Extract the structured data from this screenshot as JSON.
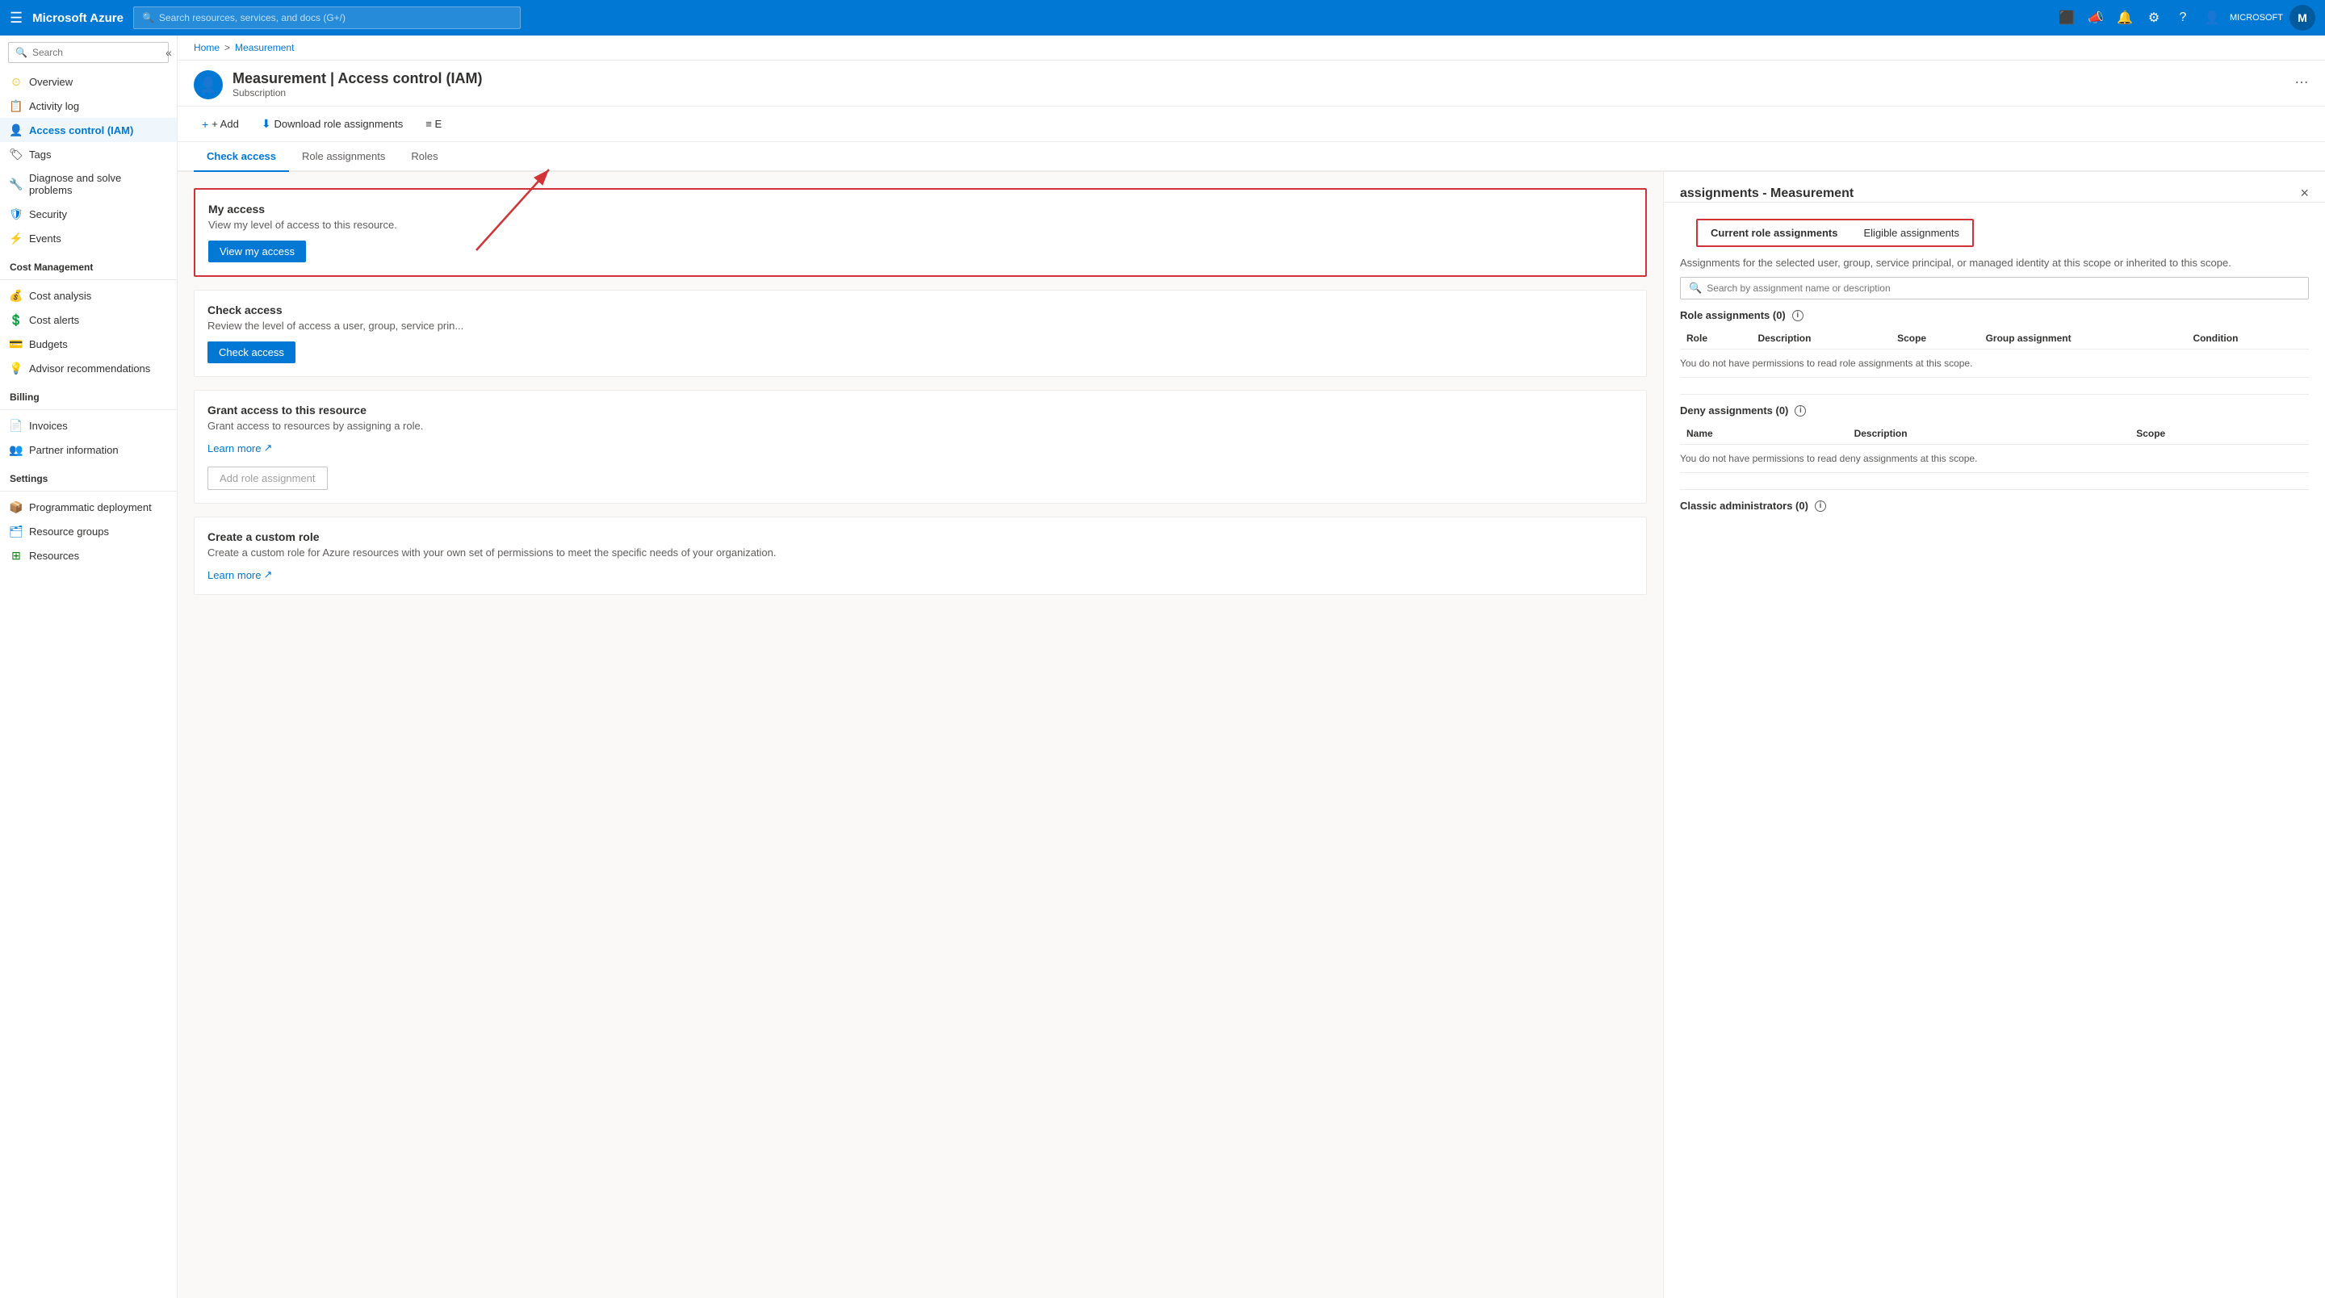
{
  "topnav": {
    "logo": "Microsoft Azure",
    "search_placeholder": "Search resources, services, and docs (G+/)",
    "user_label": "MICROSOFT"
  },
  "breadcrumb": {
    "home": "Home",
    "separator": ">",
    "current": "Measurement"
  },
  "page_header": {
    "title": "Measurement | Access control (IAM)",
    "subtitle": "Subscription"
  },
  "toolbar": {
    "add_label": "+ Add",
    "download_label": "Download role assignments",
    "more_label": "≡ E"
  },
  "tabs": {
    "items": [
      {
        "label": "Check access",
        "active": true
      },
      {
        "label": "Role assignments",
        "active": false
      },
      {
        "label": "Roles",
        "active": false
      }
    ]
  },
  "sidebar": {
    "search_placeholder": "Search",
    "items": [
      {
        "label": "Overview",
        "icon": "⊙",
        "color": "#ffc83d"
      },
      {
        "label": "Activity log",
        "icon": "📋",
        "color": "#0078d4"
      },
      {
        "label": "Access control (IAM)",
        "icon": "👤",
        "color": "#0078d4",
        "active": true
      },
      {
        "label": "Tags",
        "icon": "🏷",
        "color": "#605e5c"
      },
      {
        "label": "Diagnose and solve problems",
        "icon": "🔧",
        "color": "#605e5c"
      },
      {
        "label": "Security",
        "icon": "🛡",
        "color": "#0078d4"
      },
      {
        "label": "Events",
        "icon": "⚡",
        "color": "#ffc83d"
      }
    ],
    "cost_management_label": "Cost Management",
    "cost_items": [
      {
        "label": "Cost analysis",
        "icon": "💰",
        "color": "#107c10"
      },
      {
        "label": "Cost alerts",
        "icon": "💲",
        "color": "#107c10"
      },
      {
        "label": "Budgets",
        "icon": "💳",
        "color": "#107c10"
      },
      {
        "label": "Advisor recommendations",
        "icon": "💡",
        "color": "#0078d4"
      }
    ],
    "billing_label": "Billing",
    "billing_items": [
      {
        "label": "Invoices",
        "icon": "📄",
        "color": "#0078d4"
      },
      {
        "label": "Partner information",
        "icon": "👥",
        "color": "#605e5c"
      }
    ],
    "settings_label": "Settings",
    "settings_items": [
      {
        "label": "Programmatic deployment",
        "icon": "📦",
        "color": "#0078d4"
      },
      {
        "label": "Resource groups",
        "icon": "🗂",
        "color": "#0078d4"
      },
      {
        "label": "Resources",
        "icon": "⊞",
        "color": "#107c10"
      }
    ]
  },
  "my_access_card": {
    "title": "My access",
    "description": "View my level of access to this resource.",
    "button_label": "View my access"
  },
  "check_access_card": {
    "title": "Check access",
    "description": "Review the level of access a user, group, service prin...",
    "button_label": "Check access"
  },
  "grant_access_card": {
    "title": "Grant access to this resource",
    "description": "Grant access to resources by assigning a role.",
    "learn_more_label": "Learn more",
    "button_label": "Add role assignment"
  },
  "custom_role_card": {
    "title": "Create a custom role",
    "description": "Create a custom role for Azure resources with your own set of permissions to meet the specific needs of your organization.",
    "learn_more_label": "Learn more"
  },
  "right_panel": {
    "title": "assignments - Measurement",
    "close_label": "×",
    "tabs": [
      {
        "label": "Current role assignments",
        "active": true
      },
      {
        "label": "Eligible assignments",
        "active": false
      }
    ],
    "description": "Assignments for the selected user, group, service principal, or managed identity at this scope or inherited to this scope.",
    "search_placeholder": "Search by assignment name or description",
    "role_assignments": {
      "label": "Role assignments (0)",
      "count": 0,
      "columns": [
        "Role",
        "Description",
        "Scope",
        "Group assignment",
        "Condition"
      ],
      "no_permission_msg": "You do not have permissions to read role assignments at this scope."
    },
    "deny_assignments": {
      "label": "Deny assignments (0)",
      "count": 0,
      "columns": [
        "Name",
        "Description",
        "Scope"
      ],
      "no_permission_msg": "You do not have permissions to read deny assignments at this scope."
    },
    "classic_admins": {
      "label": "Classic administrators (0)",
      "count": 0
    }
  }
}
